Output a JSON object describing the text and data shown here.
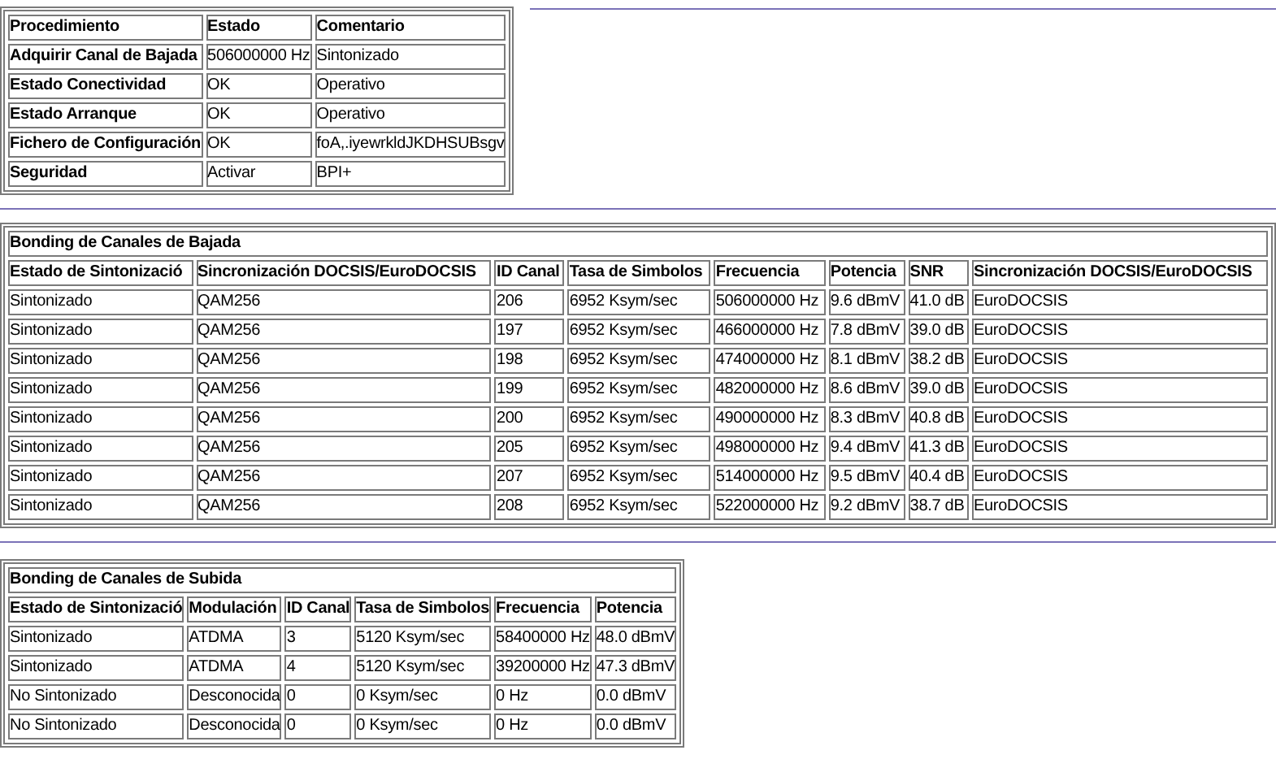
{
  "status_table": {
    "columns": [
      "Procedimiento",
      "Estado",
      "Comentario"
    ],
    "rows": [
      [
        "Adquirir Canal de Bajada",
        "506000000 Hz",
        "Sintonizado"
      ],
      [
        "Estado Conectividad",
        "OK",
        "Operativo"
      ],
      [
        "Estado Arranque",
        "OK",
        "Operativo"
      ],
      [
        "Fichero de Configuración",
        "OK",
        "foA,.iyewrkldJKDHSUBsgv"
      ],
      [
        "Seguridad",
        "Activar",
        "BPI+"
      ]
    ]
  },
  "downstream_table": {
    "title": "Bonding de Canales de Bajada",
    "columns": [
      "Estado de Sintonizació",
      "Sincronización DOCSIS/EuroDOCSIS",
      "ID Canal",
      "Tasa de Simbolos",
      "Frecuencia",
      "Potencia",
      "SNR",
      "Sincronización DOCSIS/EuroDOCSIS"
    ],
    "rows": [
      [
        "Sintonizado",
        "QAM256",
        "206",
        "6952 Ksym/sec",
        "506000000 Hz",
        "9.6 dBmV",
        "41.0 dB",
        "EuroDOCSIS"
      ],
      [
        "Sintonizado",
        "QAM256",
        "197",
        "6952 Ksym/sec",
        "466000000 Hz",
        "7.8 dBmV",
        "39.0 dB",
        "EuroDOCSIS"
      ],
      [
        "Sintonizado",
        "QAM256",
        "198",
        "6952 Ksym/sec",
        "474000000 Hz",
        "8.1 dBmV",
        "38.2 dB",
        "EuroDOCSIS"
      ],
      [
        "Sintonizado",
        "QAM256",
        "199",
        "6952 Ksym/sec",
        "482000000 Hz",
        "8.6 dBmV",
        "39.0 dB",
        "EuroDOCSIS"
      ],
      [
        "Sintonizado",
        "QAM256",
        "200",
        "6952 Ksym/sec",
        "490000000 Hz",
        "8.3 dBmV",
        "40.8 dB",
        "EuroDOCSIS"
      ],
      [
        "Sintonizado",
        "QAM256",
        "205",
        "6952 Ksym/sec",
        "498000000 Hz",
        "9.4 dBmV",
        "41.3 dB",
        "EuroDOCSIS"
      ],
      [
        "Sintonizado",
        "QAM256",
        "207",
        "6952 Ksym/sec",
        "514000000 Hz",
        "9.5 dBmV",
        "40.4 dB",
        "EuroDOCSIS"
      ],
      [
        "Sintonizado",
        "QAM256",
        "208",
        "6952 Ksym/sec",
        "522000000 Hz",
        "9.2 dBmV",
        "38.7 dB",
        "EuroDOCSIS"
      ]
    ]
  },
  "upstream_table": {
    "title": "Bonding de Canales de Subida",
    "columns": [
      "Estado de Sintonizació",
      "Modulación",
      "ID Canal",
      "Tasa de Simbolos",
      "Frecuencia",
      "Potencia"
    ],
    "rows": [
      [
        "Sintonizado",
        "ATDMA",
        "3",
        "5120 Ksym/sec",
        "58400000 Hz",
        "48.0 dBmV"
      ],
      [
        "Sintonizado",
        "ATDMA",
        "4",
        "5120 Ksym/sec",
        "39200000 Hz",
        "47.3 dBmV"
      ],
      [
        "No Sintonizado",
        "Desconocida",
        "0",
        "0 Ksym/sec",
        "0 Hz",
        "0.0 dBmV"
      ],
      [
        "No Sintonizado",
        "Desconocida",
        "0",
        "0 Ksym/sec",
        "0 Hz",
        "0.0 dBmV"
      ]
    ]
  }
}
